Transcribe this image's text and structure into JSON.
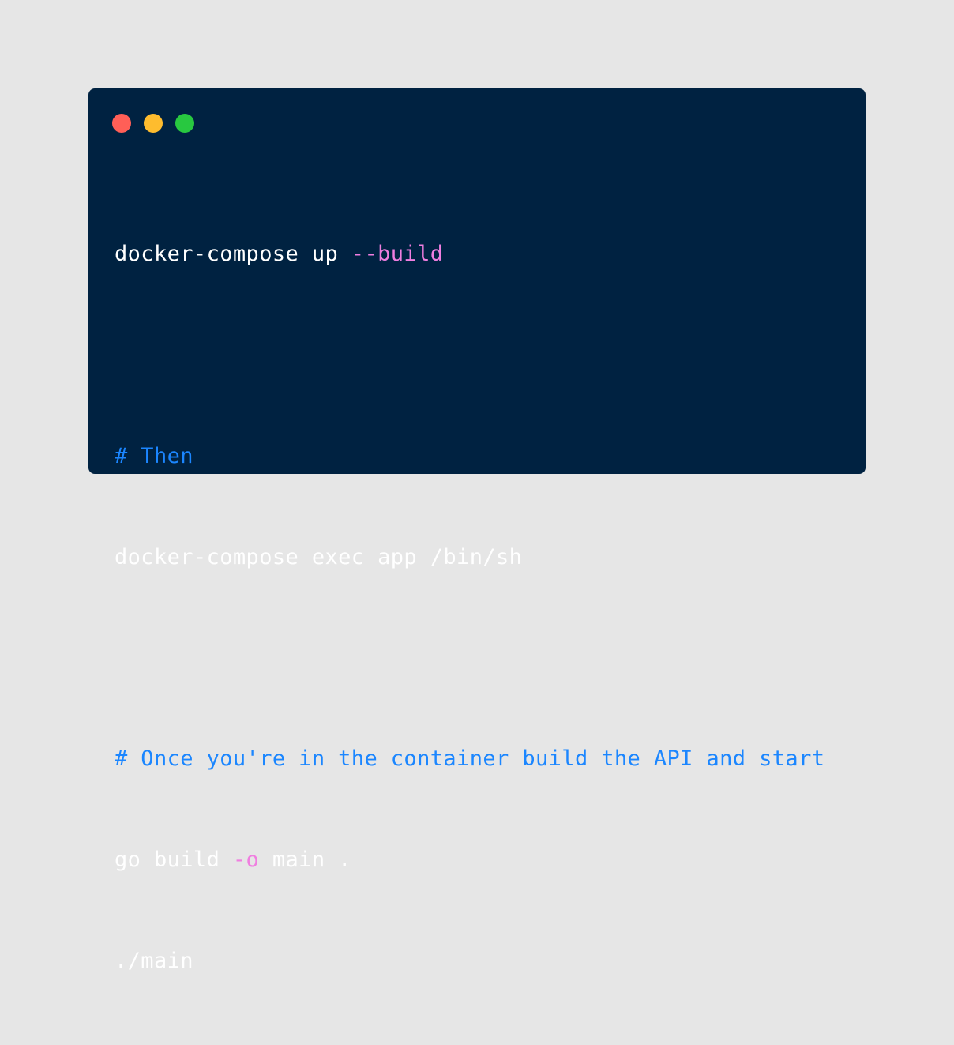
{
  "window": {
    "controls": [
      "close",
      "minimize",
      "maximize"
    ]
  },
  "colors": {
    "background": "#e6e6e6",
    "window": "#002241",
    "plain": "#ffffff",
    "flag": "#f07ee0",
    "comment": "#1b86ff"
  },
  "code": {
    "lines": [
      {
        "tokens": [
          {
            "text": "docker-compose up ",
            "kind": "plain"
          },
          {
            "text": "--build",
            "kind": "flag"
          }
        ]
      },
      {
        "tokens": []
      },
      {
        "tokens": [
          {
            "text": "# Then",
            "kind": "comment"
          }
        ]
      },
      {
        "tokens": [
          {
            "text": "docker-compose exec app /bin/sh",
            "kind": "plain"
          }
        ]
      },
      {
        "tokens": []
      },
      {
        "tokens": [
          {
            "text": "# Once you're in the container build the API and start",
            "kind": "comment"
          }
        ]
      },
      {
        "tokens": [
          {
            "text": "go build ",
            "kind": "plain"
          },
          {
            "text": "-o",
            "kind": "flag"
          },
          {
            "text": " main .",
            "kind": "plain"
          }
        ]
      },
      {
        "tokens": [
          {
            "text": "./main",
            "kind": "plain"
          }
        ]
      }
    ]
  }
}
